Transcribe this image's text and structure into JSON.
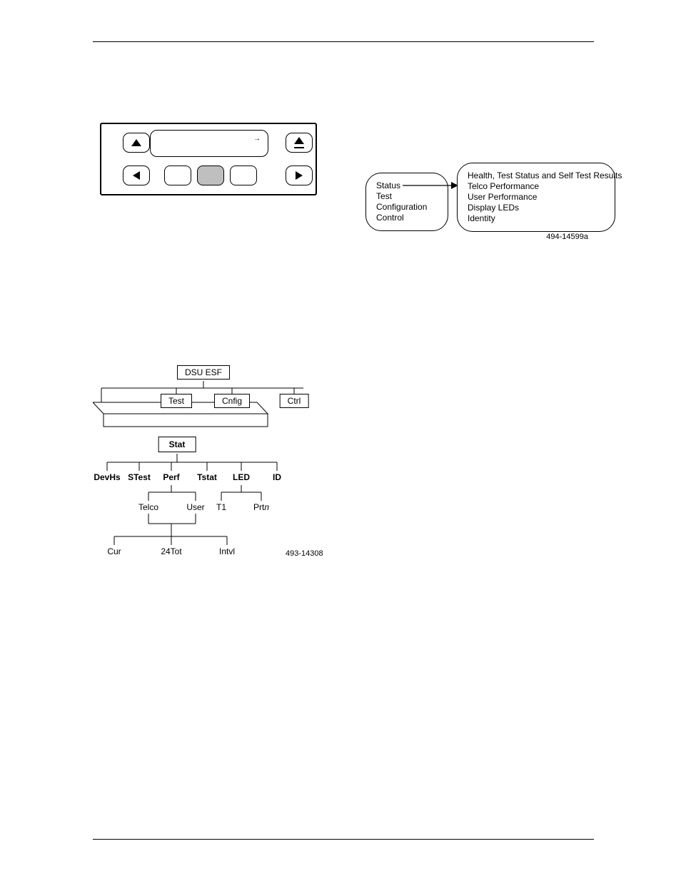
{
  "panel": {
    "lcd_arrow": "→"
  },
  "rightDiagram": {
    "leftBox": [
      "Status",
      "Test",
      "Configuration",
      "Control"
    ],
    "rightBox": [
      "Health, Test Status and Self Test Results",
      "Telco Performance",
      "User Performance",
      "Display LEDs",
      "Identity"
    ],
    "figureId": "494-14599a"
  },
  "tree": {
    "root": "DSU ESF",
    "row1": {
      "test": "Test",
      "cnfig": "Cnfig",
      "ctrl": "Ctrl"
    },
    "stat": "Stat",
    "row3": {
      "devhs": "DevHs",
      "stest": "STest",
      "perf": "Perf",
      "tstat": "Tstat",
      "led": "LED",
      "id": "ID"
    },
    "row4": {
      "telco": "Telco",
      "user": "User",
      "t1": "T1",
      "prtn_prefix": "Prt",
      "prtn_suffix": "n"
    },
    "row5": {
      "cur": "Cur",
      "tot": "24Tot",
      "intvl": "Intvl"
    },
    "figureId": "493-14308"
  }
}
